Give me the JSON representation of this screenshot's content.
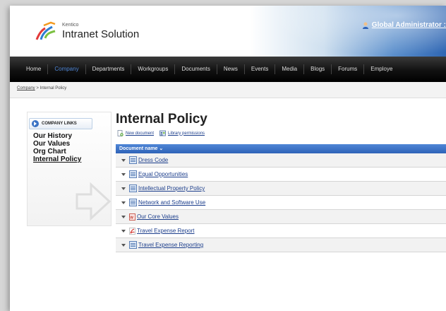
{
  "header": {
    "logo_small": "Kentico",
    "logo_text": "Intranet Solution",
    "user": "Global Administrator :"
  },
  "nav": [
    "Home",
    "Company",
    "Departments",
    "Workgroups",
    "Documents",
    "News",
    "Events",
    "Media",
    "Blogs",
    "Forums",
    "Employe"
  ],
  "nav_active_index": 1,
  "breadcrumb": {
    "parent": "Company",
    "separator": " > ",
    "current": "Internal Policy"
  },
  "sidebar": {
    "title": "COMPANY LINKS",
    "links": [
      "Our History",
      "Our Values",
      "Org Chart",
      "Internal Policy"
    ],
    "current_index": 3
  },
  "page_title": "Internal Policy",
  "actions": {
    "new_document": "New document",
    "library_permissions": "Library permissions"
  },
  "grid": {
    "header": "Document name",
    "rows": [
      {
        "name": "Dress Code",
        "icon": "word-doc-icon"
      },
      {
        "name": "Equal Opportunities",
        "icon": "word-doc-icon"
      },
      {
        "name": "Intellectual Property Policy",
        "icon": "word-doc-icon"
      },
      {
        "name": "Network and Software Use",
        "icon": "word-doc-icon"
      },
      {
        "name": "Our Core Values",
        "icon": "doc-icon"
      },
      {
        "name": "Travel Expense Report",
        "icon": "pdf-icon"
      },
      {
        "name": "Travel Expense Reporting",
        "icon": "word-doc-icon"
      }
    ]
  },
  "colors": {
    "accent": "#2e63b8",
    "nav_active": "#4f86d6",
    "link": "#1d3f8c"
  }
}
